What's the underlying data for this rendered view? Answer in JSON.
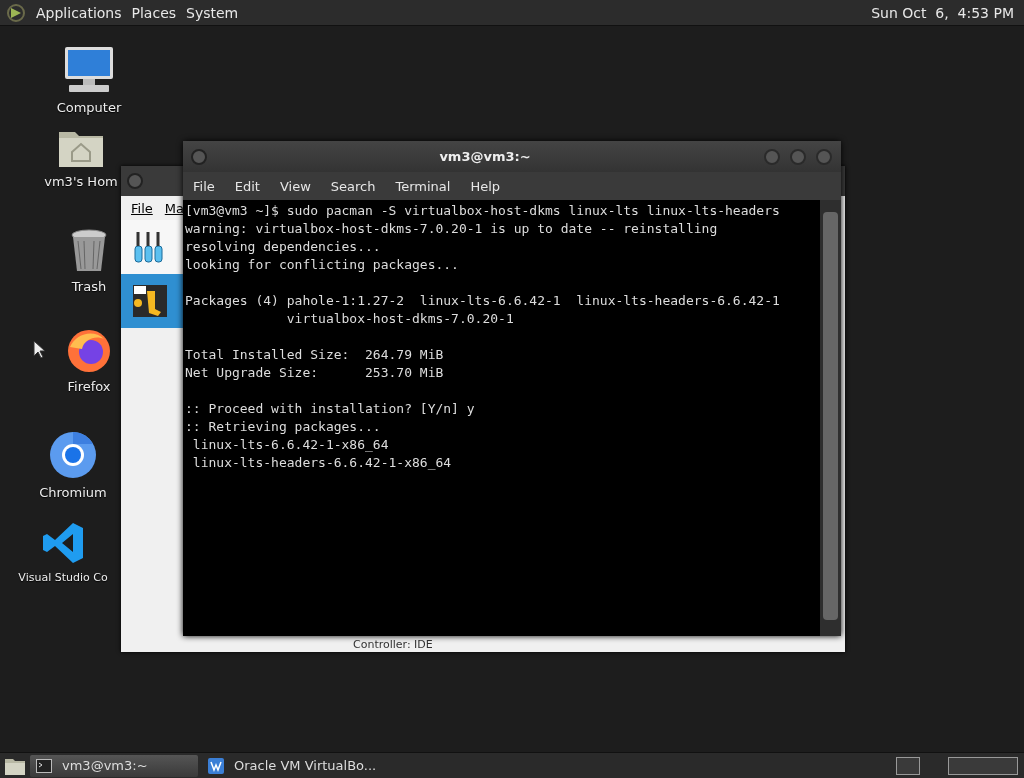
{
  "top_panel": {
    "menus": [
      "Applications",
      "Places",
      "System"
    ],
    "clock": "Sun Oct  6,  4:53 PM"
  },
  "desktop_icons": [
    {
      "kind": "computer",
      "label": "Computer"
    },
    {
      "kind": "home",
      "label": "vm3's Hom"
    },
    {
      "kind": "trash",
      "label": "Trash"
    },
    {
      "kind": "firefox",
      "label": "Firefox"
    },
    {
      "kind": "chromium",
      "label": "Chromium"
    },
    {
      "kind": "vscode",
      "label": "Visual Studio Co"
    }
  ],
  "virtualbox_window": {
    "menus": [
      "File",
      "Ma"
    ],
    "items": [
      {
        "kind": "tools",
        "selected": false
      },
      {
        "kind": "vm",
        "selected": true
      }
    ],
    "status": "Controller: IDE"
  },
  "terminal_window": {
    "title": "vm3@vm3:~",
    "menus": [
      "File",
      "Edit",
      "View",
      "Search",
      "Terminal",
      "Help"
    ],
    "output_blocks": [
      [
        "[vm3@vm3 ~]$ sudo pacman -S virtualbox-host-dkms linux-lts linux-lts-headers",
        "warning: virtualbox-host-dkms-7.0.20-1 is up to date -- reinstalling",
        "resolving dependencies...",
        "looking for conflicting packages..."
      ],
      [
        "Packages (4) pahole-1:1.27-2  linux-lts-6.6.42-1  linux-lts-headers-6.6.42-1",
        "             virtualbox-host-dkms-7.0.20-1"
      ],
      [
        "Total Installed Size:  264.79 MiB",
        "Net Upgrade Size:      253.70 MiB"
      ],
      [
        ":: Proceed with installation? [Y/n] y",
        ":: Retrieving packages...",
        " linux-lts-6.6.42-1-x86_64",
        " linux-lts-headers-6.6.42-1-x86_64"
      ]
    ]
  },
  "taskbar": {
    "tasks": [
      {
        "kind": "terminal",
        "label": "vm3@vm3:~",
        "selected": true
      },
      {
        "kind": "virtualbox",
        "label": "Oracle VM VirtualBo...",
        "selected": false
      }
    ]
  }
}
